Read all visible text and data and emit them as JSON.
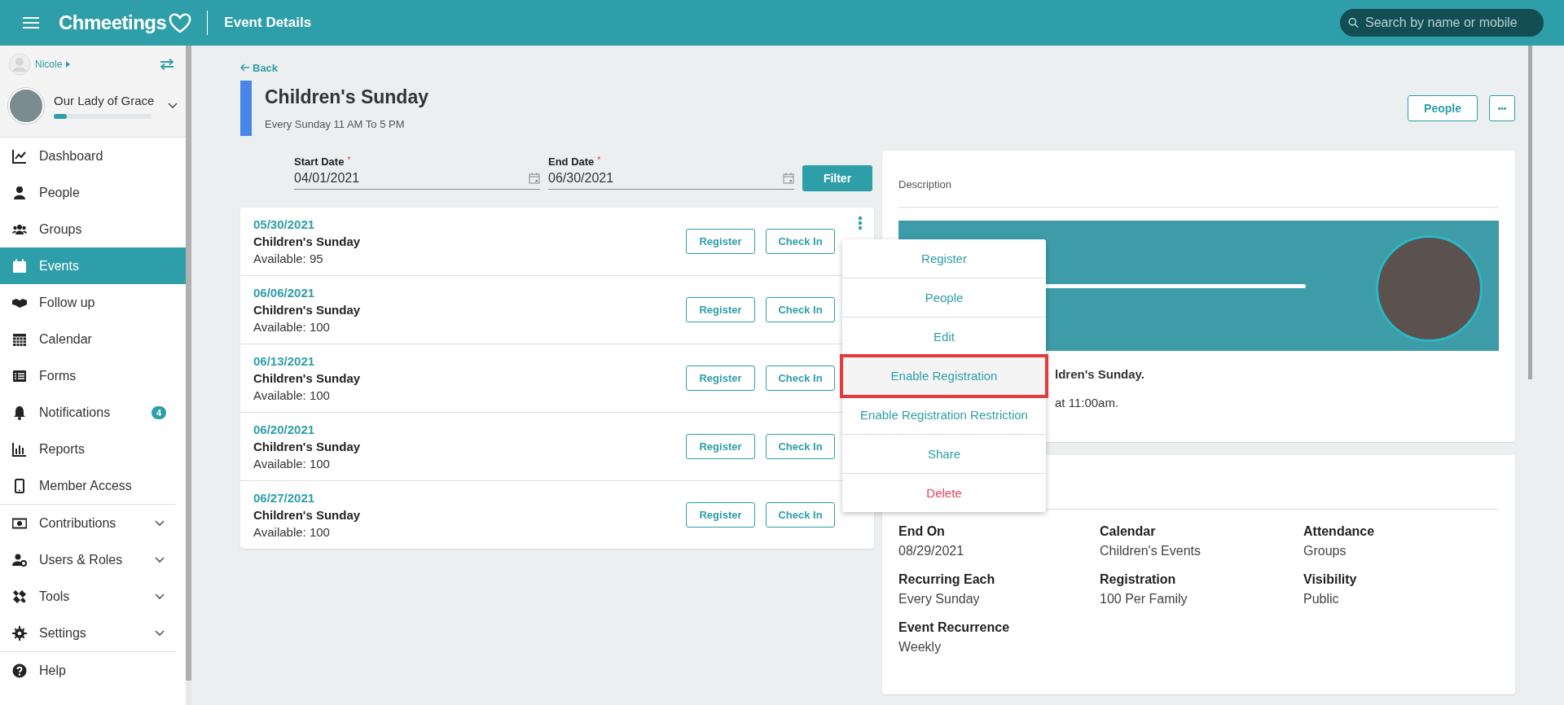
{
  "header": {
    "logo": "Chmeetings",
    "title": "Event Details",
    "search": {
      "placeholder": "Search by name or mobile"
    }
  },
  "sidebar": {
    "user": "Nicole",
    "church": {
      "name": "Our Lady of Grace",
      "level": 0.13
    },
    "sections": [
      [
        {
          "label": "Dashboard",
          "kind": "link",
          "selected": false
        },
        {
          "label": "People",
          "kind": "link",
          "selected": false
        },
        {
          "label": "Groups",
          "kind": "link",
          "selected": false
        },
        {
          "label": "Events",
          "kind": "link",
          "selected": true
        },
        {
          "label": "Follow up",
          "kind": "link",
          "selected": false
        },
        {
          "label": "Calendar",
          "kind": "link",
          "selected": false
        },
        {
          "label": "Forms",
          "kind": "link",
          "selected": false
        },
        {
          "label": "Notifications",
          "kind": "link",
          "selected": false,
          "badge": "4"
        },
        {
          "label": "Reports",
          "kind": "link",
          "selected": false
        },
        {
          "label": "Member Access",
          "kind": "link",
          "selected": false
        }
      ],
      [
        {
          "label": "Contributions",
          "kind": "group",
          "selected": false,
          "expanded": false
        },
        {
          "label": "Users & Roles",
          "kind": "group",
          "selected": false,
          "expanded": false
        },
        {
          "label": "Tools",
          "kind": "group",
          "selected": false,
          "expanded": false
        },
        {
          "label": "Settings",
          "kind": "group",
          "selected": false,
          "expanded": false
        }
      ],
      [
        {
          "label": "Help",
          "kind": "link",
          "selected": false
        }
      ]
    ]
  },
  "back": "Back",
  "event": {
    "title": "Children's Sunday",
    "schedule": "Every Sunday 11 AM To 5 PM",
    "actions": {
      "people": "People",
      "more": "•••"
    }
  },
  "filter": {
    "start": {
      "label": "Start Date",
      "required_mark": "*",
      "value": "04/01/2021"
    },
    "end": {
      "label": "End Date",
      "required_mark": "*",
      "value": "06/30/2021"
    },
    "button": "Filter"
  },
  "occurrences": [
    {
      "date": "05/30/2021",
      "name": "Children's Sunday",
      "available": "Available: 95",
      "register": "Register",
      "check_in": "Check In"
    },
    {
      "date": "06/06/2021",
      "name": "Children's Sunday",
      "available": "Available: 100",
      "register": "Register",
      "check_in": "Check In"
    },
    {
      "date": "06/13/2021",
      "name": "Children's Sunday",
      "available": "Available: 100",
      "register": "Register",
      "check_in": "Check In"
    },
    {
      "date": "06/20/2021",
      "name": "Children's Sunday",
      "available": "Available: 100",
      "register": "Register",
      "check_in": "Check In"
    },
    {
      "date": "06/27/2021",
      "name": "Children's Sunday",
      "available": "Available: 100",
      "register": "Register",
      "check_in": "Check In"
    }
  ],
  "context_menu": [
    {
      "label": "Register",
      "kind": "normal",
      "selected": false
    },
    {
      "label": "People",
      "kind": "normal",
      "selected": false
    },
    {
      "label": "Edit",
      "kind": "normal",
      "selected": false
    },
    {
      "label": "Enable Registration",
      "kind": "normal",
      "selected": true
    },
    {
      "label": "Enable Registration Restriction",
      "kind": "normal",
      "selected": false
    },
    {
      "label": "Share",
      "kind": "normal",
      "selected": false
    },
    {
      "label": "Delete",
      "kind": "danger",
      "selected": false
    }
  ],
  "description": {
    "heading": "Description",
    "lines": [
      {
        "text": "ldren's Sunday.",
        "bold": true
      },
      {
        "text": "at 11:00am.",
        "bold": false
      }
    ]
  },
  "details": [
    {
      "label": "End On",
      "value": "08/29/2021"
    },
    {
      "label": "Calendar",
      "value": "Children's Events"
    },
    {
      "label": "Attendance",
      "value": "Groups"
    },
    {
      "label": "Recurring Each",
      "value": "Every Sunday"
    },
    {
      "label": "Registration",
      "value": "100 Per Family"
    },
    {
      "label": "Visibility",
      "value": "Public"
    },
    {
      "label": "Event Recurrence",
      "value": "Weekly"
    }
  ]
}
